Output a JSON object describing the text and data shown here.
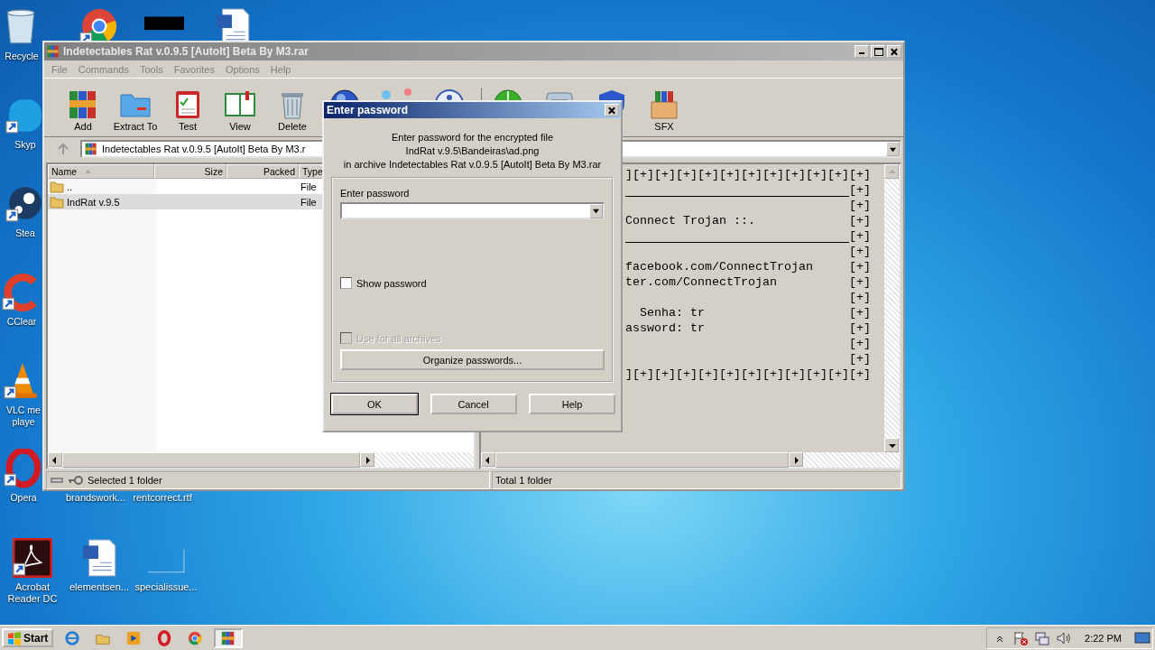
{
  "desktop": {
    "icons": [
      {
        "kind": "recycle-bin",
        "label": "Recycle"
      },
      {
        "kind": "skype",
        "label": "Skyp",
        "shortcut": true
      },
      {
        "kind": "steam",
        "label": "Stea",
        "shortcut": true
      },
      {
        "kind": "ccleaner",
        "label": "CClear",
        "shortcut": true
      },
      {
        "kind": "vlc",
        "label": "VLC me\nplaye",
        "shortcut": true
      },
      {
        "kind": "opera",
        "label": "Opera",
        "shortcut": true
      },
      {
        "kind": "acrobat",
        "label": "Acrobat\nReader DC",
        "shortcut": true
      },
      {
        "kind": "chrome",
        "shortcut": true
      },
      {
        "kind": "block"
      },
      {
        "kind": "word"
      },
      {
        "kind": "none",
        "label": "brandswork..."
      },
      {
        "kind": "none",
        "label": "rentcorrect.rtf"
      },
      {
        "kind": "word",
        "label": "elementsen..."
      },
      {
        "kind": "frame",
        "label": "specialissue..."
      }
    ]
  },
  "window": {
    "title": "Indetectables Rat v.0.9.5 [AutoIt] Beta By M3.rar",
    "menu": [
      "File",
      "Commands",
      "Tools",
      "Favorites",
      "Options",
      "Help"
    ],
    "toolbar": [
      {
        "kind": "add",
        "label": "Add"
      },
      {
        "kind": "extract",
        "label": "Extract To"
      },
      {
        "kind": "test",
        "label": "Test"
      },
      {
        "kind": "view",
        "label": "View"
      },
      {
        "kind": "delete",
        "label": "Delete"
      },
      {
        "kind": "find"
      },
      {
        "kind": "wizard"
      },
      {
        "kind": "info"
      },
      {
        "kind": "scan"
      },
      {
        "kind": "comment"
      },
      {
        "kind": "protect"
      },
      {
        "kind": "sfx",
        "label": "SFX"
      }
    ],
    "address": "Indetectables Rat v.0.9.5 [AutoIt] Beta By M3.r",
    "file_list": {
      "columns": [
        {
          "label": "Name",
          "sorted": true
        },
        {
          "label": "Size"
        },
        {
          "label": "Packed"
        },
        {
          "label": "Type"
        }
      ],
      "rows": [
        {
          "name": "..",
          "type": "File",
          "selected": false
        },
        {
          "name": "IndRat v.9.5",
          "type": "File",
          "selected": true
        }
      ]
    },
    "comment_lines": [
      {
        "kind": "full",
        "text": "][+][+][+][+][+][+][+][+][+][+][+]"
      },
      {
        "kind": "rule",
        "mark": "[+]"
      },
      {
        "kind": "text",
        "mark": "[+]"
      },
      {
        "kind": "text",
        "text": "Connect Trojan ::.",
        "mark": "[+]"
      },
      {
        "kind": "rule",
        "mark": "[+]"
      },
      {
        "kind": "text",
        "mark": "[+]"
      },
      {
        "kind": "text",
        "text": "facebook.com/ConnectTrojan",
        "mark": "[+]"
      },
      {
        "kind": "text",
        "text": "ter.com/ConnectTrojan",
        "mark": "[+]"
      },
      {
        "kind": "text",
        "mark": "[+]"
      },
      {
        "kind": "text",
        "text": "  Senha: tr",
        "mark": "[+]"
      },
      {
        "kind": "text",
        "text": "assword: tr",
        "mark": "[+]"
      },
      {
        "kind": "text",
        "mark": "[+]"
      },
      {
        "kind": "text",
        "mark": "[+]"
      },
      {
        "kind": "full",
        "text": "][+][+][+][+][+][+][+][+][+][+][+]"
      }
    ],
    "status_left": "Selected 1 folder",
    "status_right": "Total 1 folder"
  },
  "dialog": {
    "title": "Enter password",
    "message": [
      "Enter password for the encrypted file",
      "IndRat v.9.5\\Bandeiras\\ad.png",
      "in archive Indetectables Rat v.0.9.5 [AutoIt] Beta By M3.rar"
    ],
    "field_label": "Enter password",
    "options": [
      {
        "label": "Show password",
        "checked": false,
        "disabled": false
      },
      {
        "label": "Use for all archives",
        "checked": false,
        "disabled": true
      }
    ],
    "organize": "Organize passwords...",
    "buttons": [
      {
        "label": "OK",
        "default": true
      },
      {
        "label": "Cancel",
        "default": false
      },
      {
        "label": "Help",
        "default": false
      }
    ]
  },
  "taskbar": {
    "start": "Start",
    "apps": [
      {
        "kind": "ie",
        "selected": false
      },
      {
        "kind": "explorer",
        "selected": false
      },
      {
        "kind": "media",
        "selected": false
      },
      {
        "kind": "opera",
        "selected": false
      },
      {
        "kind": "chrome",
        "selected": false
      },
      {
        "kind": "winrar",
        "selected": true
      }
    ],
    "clock": "2:22 PM"
  }
}
